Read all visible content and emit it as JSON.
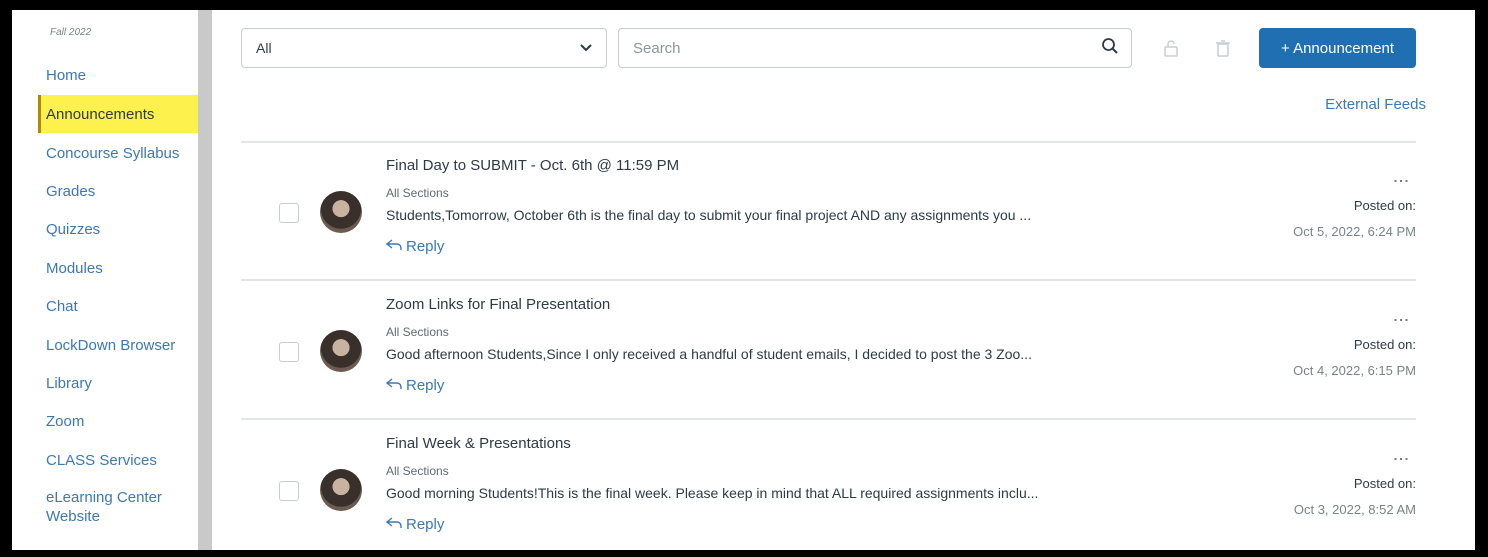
{
  "sidebar": {
    "term": "Fall 2022",
    "items": [
      {
        "label": "Home"
      },
      {
        "label": "Announcements",
        "active": true
      },
      {
        "label": "Concourse Syllabus"
      },
      {
        "label": "Grades"
      },
      {
        "label": "Quizzes"
      },
      {
        "label": "Modules"
      },
      {
        "label": "Chat"
      },
      {
        "label": "LockDown Browser"
      },
      {
        "label": "Library"
      },
      {
        "label": "Zoom"
      },
      {
        "label": "CLASS Services"
      },
      {
        "label": "eLearning Center Website"
      }
    ]
  },
  "toolbar": {
    "filter_value": "All",
    "search_placeholder": "Search",
    "new_button_label": "+ Announcement",
    "external_feeds_label": "External Feeds"
  },
  "icons": {
    "filter": "chevron-down-icon",
    "search": "search-icon",
    "lock": "lock-icon",
    "delete": "trash-icon",
    "reply": "reply-icon",
    "options": "more-vertical-icon"
  },
  "colors": {
    "accent": "#1f6fb2",
    "link": "#3b78b5",
    "active_highlight": "#fdf14d"
  },
  "announcements": [
    {
      "title": "Final Day to SUBMIT - Oct. 6th @ 11:59 PM",
      "section": "All Sections",
      "preview": "Students,Tomorrow, October 6th is the final day to submit your final project AND any assignments you ...",
      "reply_label": "Reply",
      "posted_label": "Posted on:",
      "posted_date": "Oct 5, 2022, 6:24 PM"
    },
    {
      "title": "Zoom Links for Final Presentation",
      "section": "All Sections",
      "preview": "Good afternoon Students,Since I only received a handful of student emails, I decided to post the 3 Zoo...",
      "reply_label": "Reply",
      "posted_label": "Posted on:",
      "posted_date": "Oct 4, 2022, 6:15 PM"
    },
    {
      "title": "Final Week & Presentations",
      "section": "All Sections",
      "preview": "Good morning Students!This is the final week.  Please keep in mind that ALL required assignments inclu...",
      "reply_label": "Reply",
      "posted_label": "Posted on:",
      "posted_date": "Oct 3, 2022, 8:52 AM"
    }
  ]
}
